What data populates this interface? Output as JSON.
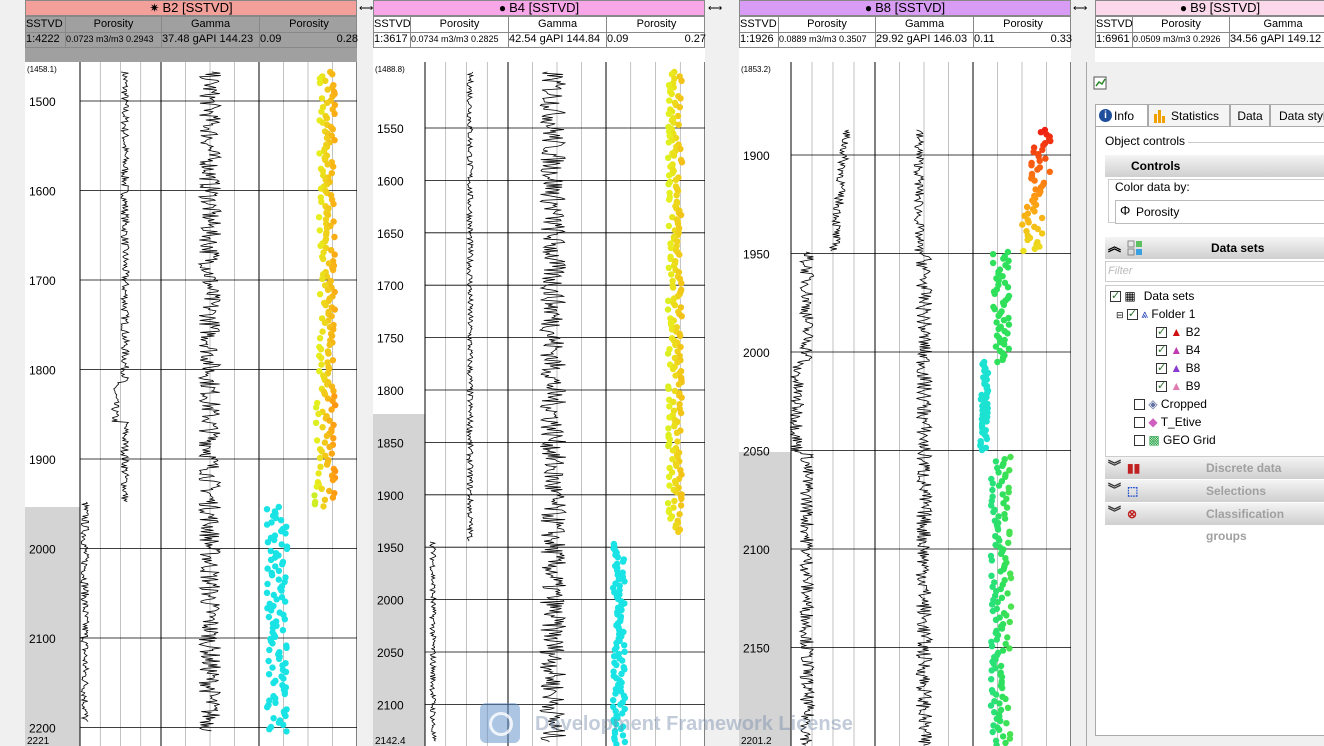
{
  "wells": [
    {
      "id": "B2",
      "title": "B2 [SSTVD]",
      "marker": "sun",
      "title_color": "#f4a09a",
      "header_fill": "#a0a0a0",
      "scale": "1:4222",
      "columns": [
        {
          "name": "SSTVD"
        },
        {
          "name": "Porosity",
          "range": "0.0723 m3/m3 0.2943"
        },
        {
          "name": "Gamma",
          "range": "37.48  gAPI  144.23"
        },
        {
          "name": "Porosity",
          "range_left": "0.09",
          "range_right": "0.28"
        }
      ],
      "top_label": "(1458.1)",
      "bottom_label": "2221",
      "depth_labels": [
        "1500",
        "1600",
        "1700",
        "1800",
        "1900",
        "2000",
        "2100",
        "2200"
      ]
    },
    {
      "id": "B4",
      "title": "B4 [SSTVD]",
      "marker": "dot",
      "title_color": "#f7a6e8",
      "header_fill": "#ffffff",
      "scale": "1:3617",
      "columns": [
        {
          "name": "SSTVD"
        },
        {
          "name": "Porosity",
          "range": "0.0734 m3/m3 0.2825"
        },
        {
          "name": "Gamma",
          "range": "42.54  gAPI  144.84"
        },
        {
          "name": "Porosity",
          "range_left": "0.09",
          "range_right": "0.27"
        }
      ],
      "top_label": "(1488.8)",
      "bottom_label": "2142.4",
      "depth_labels": [
        "1550",
        "1600",
        "1650",
        "1700",
        "1750",
        "1800",
        "1850",
        "1900",
        "1950",
        "2000",
        "2050",
        "2100"
      ]
    },
    {
      "id": "B8",
      "title": "B8 [SSTVD]",
      "marker": "dot",
      "title_color": "#d89cf5",
      "header_fill": "#ffffff",
      "scale": "1:1926",
      "columns": [
        {
          "name": "SSTVD"
        },
        {
          "name": "Porosity",
          "range": "0.0889 m3/m3 0.3507"
        },
        {
          "name": "Gamma",
          "range": "29.92  gAPI  146.03"
        },
        {
          "name": "Porosity",
          "range_left": "0.11",
          "range_right": "0.33"
        }
      ],
      "top_label": "(1853.2)",
      "bottom_label": "2201.2",
      "depth_labels": [
        "1900",
        "1950",
        "2000",
        "2050",
        "2100",
        "2150"
      ]
    },
    {
      "id": "B9",
      "title": "B9 [SSTVD]",
      "marker": "dot",
      "title_color": "#fbd9ea",
      "header_fill": "#ffffff",
      "scale": "1:6961",
      "columns": [
        {
          "name": "SSTVD"
        },
        {
          "name": "Porosity",
          "range": "0.0509 m3/m3 0.2926"
        },
        {
          "name": "Gamma",
          "range": "34.56  gAPI  149.12"
        }
      ]
    }
  ],
  "panel": {
    "tabs": [
      "Info",
      "Statistics",
      "Data",
      "Data style"
    ],
    "object_controls": "Object controls",
    "controls_title": "Controls",
    "color_by_label": "Color data by:",
    "color_by_value": "Porosity",
    "datasets_title": "Data sets",
    "filter_placeholder": "Filter",
    "tree": {
      "root": "Data sets",
      "folder": "Folder 1",
      "wells": [
        "B2",
        "B4",
        "B8",
        "B9"
      ],
      "others": [
        "Cropped",
        "T_Etive",
        "GEO Grid"
      ]
    },
    "sections_collapsed": [
      "Discrete data",
      "Selections",
      "Classification groups"
    ]
  },
  "watermark": "Development Framework License",
  "colors": {
    "cyan": "#17e3f0",
    "green": "#2ee05a",
    "yellow": "#e6f01e",
    "orange": "#ff9a12",
    "red": "#ef1f10",
    "outside_fill": "#d4d4d4"
  }
}
